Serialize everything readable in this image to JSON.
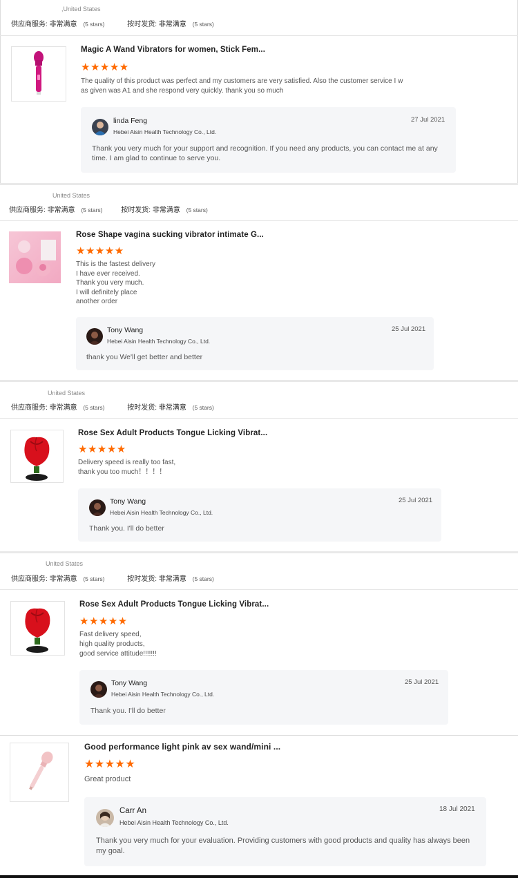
{
  "reviews": [
    {
      "country": ",United States",
      "supplier_label": "供应商服务:",
      "supplier_value": "非常满意",
      "supplier_stars": "(5 stars)",
      "shipping_label": "按时发货:",
      "shipping_value": "非常满意",
      "shipping_stars": "(5 stars)",
      "product_title": "Magic A Wand Vibrators for women, Stick Fem...",
      "stars": "★★★★★",
      "review_text": "The quality of this product was perfect and my customers are very satisfied. Also the customer service I w\nas given was A1 and she respond very quickly. thank you so much",
      "reply": {
        "name": "linda Feng",
        "company": "Hebei Aisin Health Technology Co., Ltd.",
        "date": "27 Jul 2021",
        "message": "Thank you very much for your support and recognition. If you need any products, you can contact me at any time. I am glad to continue to serve you."
      }
    },
    {
      "country": "United States",
      "supplier_label": "供应商服务:",
      "supplier_value": "非常满意",
      "supplier_stars": "(5 stars)",
      "shipping_label": "按时发货:",
      "shipping_value": "非常满意",
      "shipping_stars": "(5 stars)",
      "product_title": "Rose Shape vagina sucking vibrator intimate G...",
      "stars": "★★★★★",
      "review_text": "This is the fastest delivery\nI have ever received.\nThank you very much.\n I will definitely place\nanother order",
      "reply": {
        "name": "Tony Wang",
        "company": "Hebei Aisin Health Technology Co., Ltd.",
        "date": "25 Jul 2021",
        "message": "thank you We'll get better and better"
      }
    },
    {
      "country": "United States",
      "supplier_label": "供应商服务:",
      "supplier_value": "非常满意",
      "supplier_stars": "(5 stars)",
      "shipping_label": "按时发货:",
      "shipping_value": "非常满意",
      "shipping_stars": "(5 stars)",
      "product_title": "Rose Sex Adult Products Tongue Licking Vibrat...",
      "stars": "★★★★★",
      "review_text": "Delivery speed is really too fast,\nthank you too much！！！！",
      "reply": {
        "name": "Tony Wang",
        "company": "Hebei Aisin Health Technology Co., Ltd.",
        "date": "25 Jul 2021",
        "message": "Thank you. I'll do better"
      }
    },
    {
      "country": "United States",
      "supplier_label": "供应商服务:",
      "supplier_value": "非常满意",
      "supplier_stars": "(5 stars)",
      "shipping_label": "按时发货:",
      "shipping_value": "非常满意",
      "shipping_stars": "(5 stars)",
      "product_title": "Rose Sex Adult Products Tongue Licking Vibrat...",
      "stars": "★★★★★",
      "review_text": "Fast delivery speed,\nhigh quality products,\ngood service attitude!!!!!!!",
      "reply": {
        "name": "Tony Wang",
        "company": "Hebei Aisin Health Technology Co., Ltd.",
        "date": "25 Jul 2021",
        "message": "Thank you. I'll do better"
      }
    },
    {
      "product_title": "Good performance light pink av sex wand/mini ...",
      "stars": "★★★★★",
      "review_text": "Great product",
      "reply": {
        "name": "Carr An",
        "company": "Hebei Aisin Health Technology Co., Ltd.",
        "date": "18 Jul 2021",
        "message": "Thank you very much for your evaluation. Providing customers with good products and quality has always been my goal."
      }
    }
  ],
  "colors": {
    "star": "#ff6a00",
    "reply_bg": "#f5f6f8"
  },
  "icons": [
    "wand-product-image",
    "rose-product-image",
    "avatar-image"
  ]
}
